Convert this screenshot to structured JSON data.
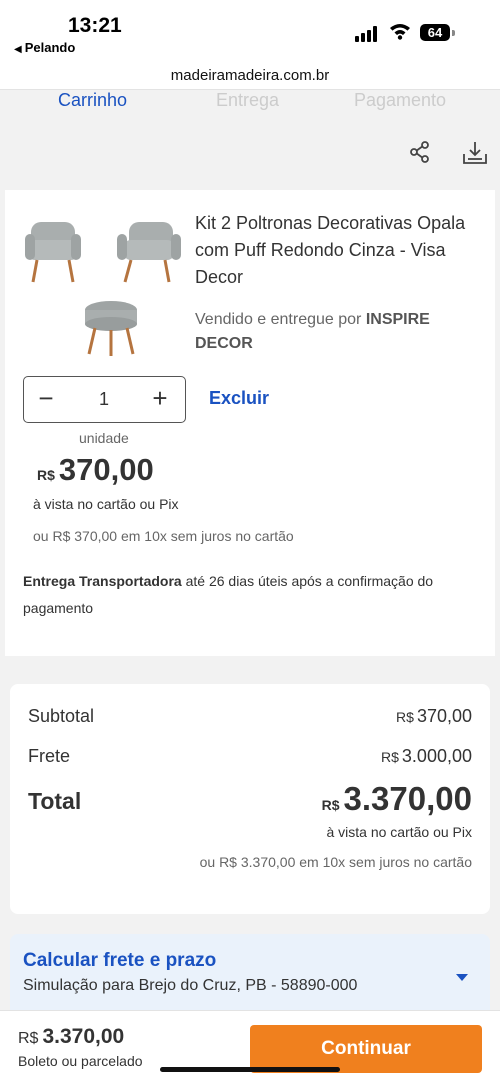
{
  "status_bar": {
    "time": "13:21",
    "back_app": "Pelando",
    "battery": "64",
    "url": "madeiramadeira.com.br"
  },
  "steps": [
    "Carrinho",
    "Entrega",
    "Pagamento"
  ],
  "product": {
    "title": "Kit 2 Poltronas Decorativas Opala com Puff Redondo Cinza - Visa Decor",
    "seller_prefix": "Vendido e entregue por",
    "seller_name": "INSPIRE DECOR",
    "quantity": "1",
    "remove_label": "Excluir",
    "unit_label": "unidade",
    "currency": "R$",
    "price": "370,00",
    "price_note": "à vista no cartão ou Pix",
    "installments": "ou R$ 370,00 em 10x sem juros no cartão",
    "delivery_method": "Entrega Transportadora",
    "delivery_text": "até 26 dias úteis após a confirmação do pagamento"
  },
  "summary": {
    "subtotal_label": "Subtotal",
    "subtotal_value": "370,00",
    "shipping_label": "Frete",
    "shipping_value": "3.000,00",
    "total_label": "Total",
    "total_value": "3.370,00",
    "currency": "R$",
    "total_note": "à vista no cartão ou Pix",
    "total_installments": "ou R$ 3.370,00 em 10x sem juros no cartão"
  },
  "shipping_calc": {
    "title": "Calcular frete e prazo",
    "subtitle": "Simulação para Brejo do Cruz, PB - 58890-000"
  },
  "bottom_bar": {
    "currency": "R$",
    "price": "3.370,00",
    "note": "Boleto ou parcelado",
    "continue_label": "Continuar"
  },
  "colors": {
    "accent_blue": "#1a52c1",
    "cta_orange": "#f0801e",
    "shipping_bg": "#eaf2fb"
  }
}
